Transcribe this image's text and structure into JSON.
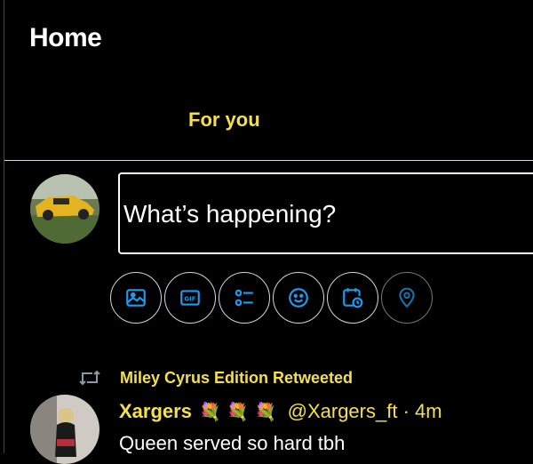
{
  "header": {
    "title": "Home",
    "tabs": [
      {
        "label": "For you"
      }
    ]
  },
  "composer": {
    "placeholder": "What’s happening?",
    "tools": [
      {
        "icon": "image-icon"
      },
      {
        "icon": "gif-icon"
      },
      {
        "icon": "poll-icon"
      },
      {
        "icon": "emoji-icon"
      },
      {
        "icon": "schedule-icon"
      },
      {
        "icon": "location-icon"
      }
    ]
  },
  "feed": {
    "items": [
      {
        "retweeted_by": "Miley Cyrus Edition Retweeted",
        "author_name": "Xargers",
        "author_emoji": "💐 💐 💐",
        "handle": "@Xargers_ft",
        "separator": "·",
        "time": "4m",
        "text": "Queen served so hard tbh"
      }
    ]
  },
  "colors": {
    "accent": "#f4e04d",
    "icon_blue": "#1d9bf0",
    "background": "#000000"
  }
}
